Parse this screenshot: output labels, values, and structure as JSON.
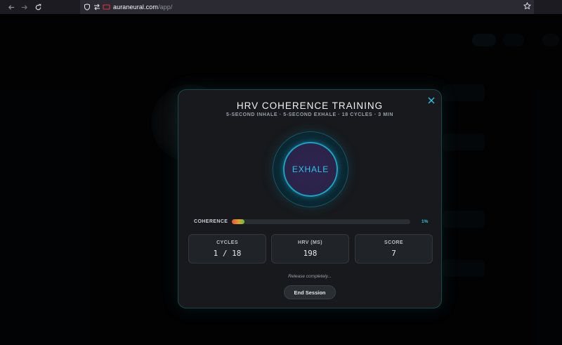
{
  "browser": {
    "url_domain": "auraneural.com",
    "url_path": "/app/",
    "icons": [
      "back-arrow-icon",
      "forward-arrow-icon",
      "reload-icon",
      "shield-icon",
      "connection-icon",
      "camera-icon",
      "bookmark-star-icon"
    ]
  },
  "modal": {
    "title": "HRV COHERENCE TRAINING",
    "subtitle": "5-SECOND INHALE · 5-SECOND EXHALE · 18 CYCLES · 3 MIN",
    "close_icon": "close-icon",
    "breath_phase": "EXHALE",
    "coherence": {
      "label": "COHERENCE",
      "percent_text": "1%",
      "fill_fraction": 0.07,
      "gradient_colors": [
        "#e7533a",
        "#e2a12c",
        "#5dc04c"
      ]
    },
    "stats": [
      {
        "label": "CYCLES",
        "value": "1 / 18"
      },
      {
        "label": "HRV (MS)",
        "value": "198"
      },
      {
        "label": "SCORE",
        "value": "7"
      }
    ],
    "prompt": "Release completely...",
    "end_button": "End Session"
  },
  "colors": {
    "accent": "#2bc6e6",
    "modal_border": "#16484f",
    "modal_bg": "#17191c"
  }
}
